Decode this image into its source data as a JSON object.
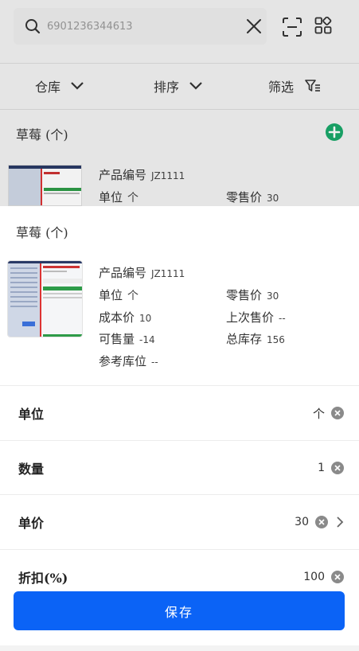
{
  "search": {
    "placeholder": "6901236344613"
  },
  "filters": [
    {
      "label": "仓库"
    },
    {
      "label": "排序"
    },
    {
      "label": "筛选"
    }
  ],
  "background": {
    "group_title": "草莓 (个)",
    "product_code_label": "产品编号",
    "product_code": "JZ1111",
    "unit_label": "单位",
    "unit": "个",
    "retail_label": "零售价",
    "retail": "30"
  },
  "sheet": {
    "title": "草莓 (个)",
    "info": {
      "product_code_label": "产品编号",
      "product_code": "JZ1111",
      "unit_label": "单位",
      "unit": "个",
      "retail_label": "零售价",
      "retail": "30",
      "cost_label": "成本价",
      "cost": "10",
      "last_price_label": "上次售价",
      "last_price": "--",
      "available_label": "可售量",
      "available": "-14",
      "total_stock_label": "总库存",
      "total_stock": "156",
      "ref_location_label": "参考库位",
      "ref_location": "--"
    },
    "fields": [
      {
        "label": "单位",
        "value": "个"
      },
      {
        "label": "数量",
        "value": "1"
      },
      {
        "label": "单价",
        "value": "30"
      },
      {
        "label": "折扣(%)",
        "value": "100"
      }
    ],
    "save_label": "保存"
  },
  "colors": {
    "accent": "#0b63f6",
    "add_green": "#1aa86a"
  }
}
